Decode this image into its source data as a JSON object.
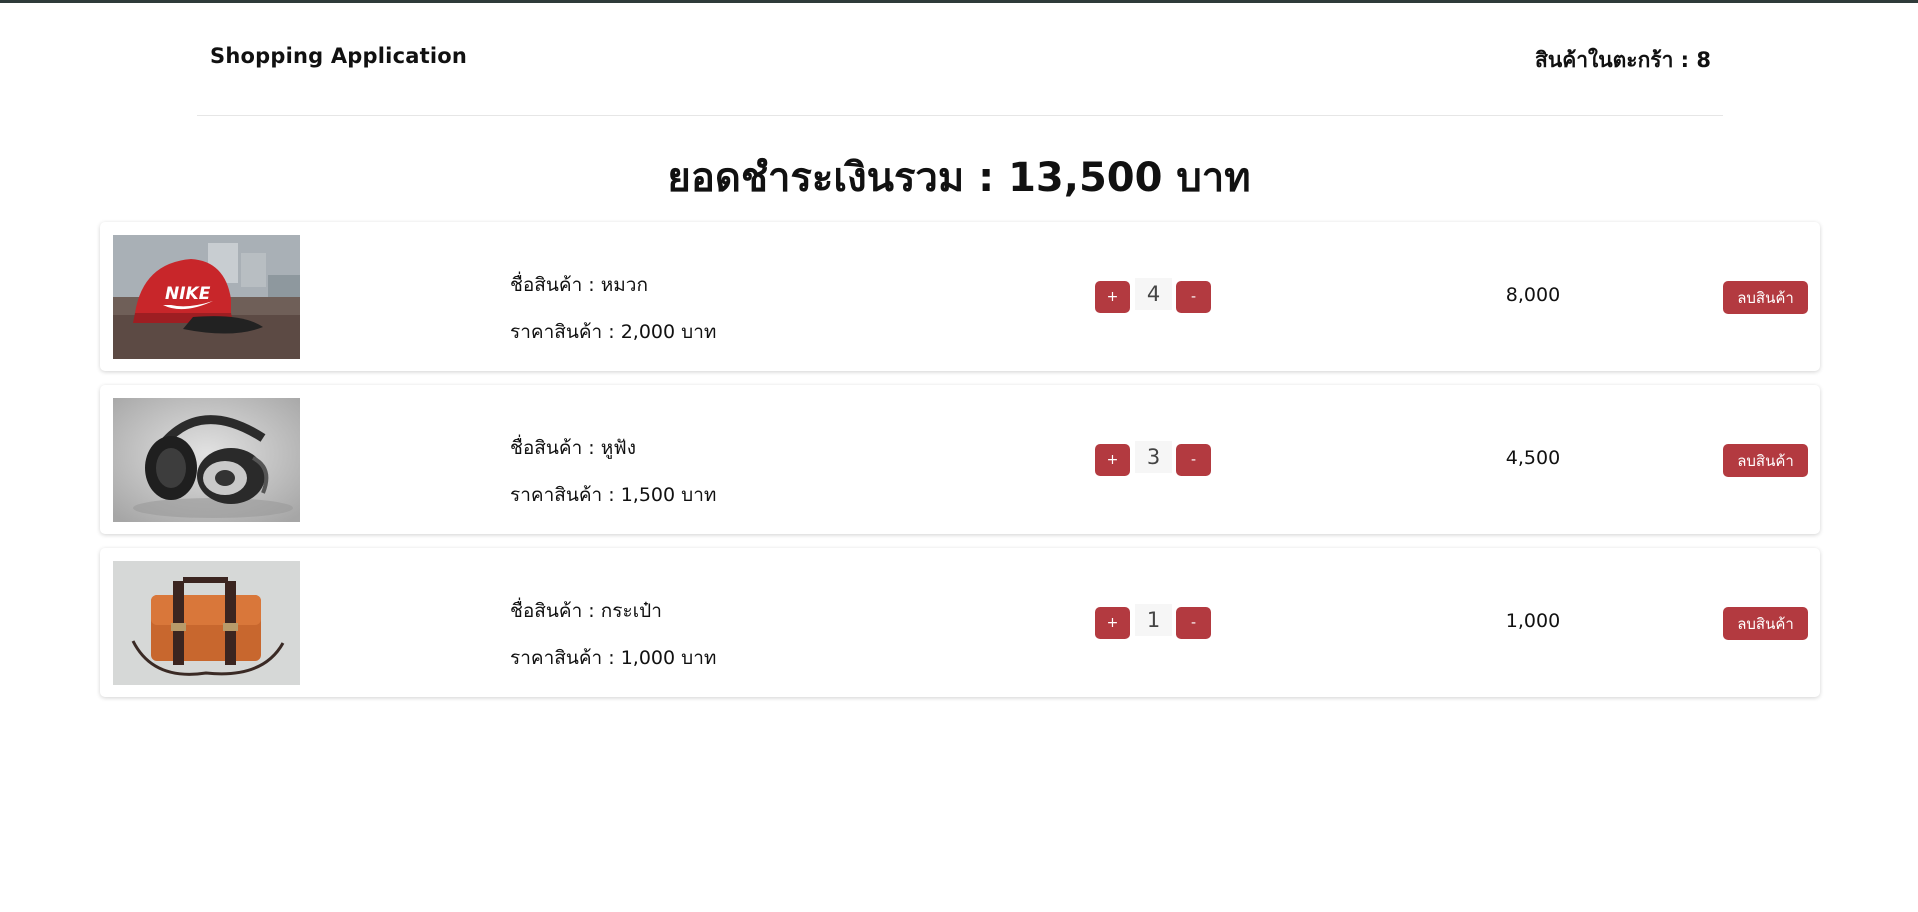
{
  "header": {
    "brand": "Shopping Application",
    "cart_count_label": "สินค้าในตะกร้า : 8"
  },
  "summary": {
    "total_label": "ยอดชำระเงินรวม : 13,500 บาท"
  },
  "items": [
    {
      "image": "red-cap-photo",
      "name_label": "ชื่อสินค้า : หมวก",
      "price_label": "ราคาสินค้า : 2,000 บาท",
      "quantity": "4",
      "line_total": "8,000",
      "plus_label": "+",
      "minus_label": "-",
      "remove_label": "ลบสินค้า"
    },
    {
      "image": "headphones-photo",
      "name_label": "ชื่อสินค้า : หูฟัง",
      "price_label": "ราคาสินค้า : 1,500 บาท",
      "quantity": "3",
      "line_total": "4,500",
      "plus_label": "+",
      "minus_label": "-",
      "remove_label": "ลบสินค้า"
    },
    {
      "image": "leather-bag-photo",
      "name_label": "ชื่อสินค้า : กระเป๋า",
      "price_label": "ราคาสินค้า : 1,000 บาท",
      "quantity": "1",
      "line_total": "1,000",
      "plus_label": "+",
      "minus_label": "-",
      "remove_label": "ลบสินค้า"
    }
  ],
  "colors": {
    "accent_button": "#b33a40",
    "top_border": "#2f3b3a"
  }
}
